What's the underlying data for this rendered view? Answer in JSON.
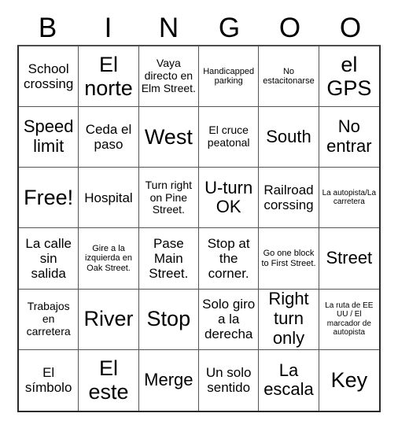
{
  "card": {
    "title": "BINGOO Card",
    "header_letters": [
      "B",
      "I",
      "N",
      "G",
      "O",
      "O"
    ],
    "columns": 6,
    "rows": 6,
    "colors": {
      "text": "#000000",
      "grid_line": "#555555",
      "border": "#2b2b2b",
      "background": "#ffffff"
    },
    "cells": [
      {
        "text": "School crossing",
        "size": "fs-md"
      },
      {
        "text": "El norte",
        "size": "fs-xl"
      },
      {
        "text": "Vaya directo en Elm Street.",
        "size": "fs-sm"
      },
      {
        "text": "Handicapped parking",
        "size": "fs-xs"
      },
      {
        "text": "No estacitonarse",
        "size": "fs-xs"
      },
      {
        "text": "el GPS",
        "size": "fs-xl"
      },
      {
        "text": "Speed limit",
        "size": "fs-lg"
      },
      {
        "text": "Ceda el paso",
        "size": "fs-md"
      },
      {
        "text": "West",
        "size": "fs-xl"
      },
      {
        "text": "El cruce peatonal",
        "size": "fs-sm"
      },
      {
        "text": "South",
        "size": "fs-lg"
      },
      {
        "text": "No entrar",
        "size": "fs-lg"
      },
      {
        "text": "Free!",
        "size": "fs-xl"
      },
      {
        "text": "Hospital",
        "size": "fs-md"
      },
      {
        "text": "Turn right on Pine Street.",
        "size": "fs-sm"
      },
      {
        "text": "U-turn OK",
        "size": "fs-lg"
      },
      {
        "text": "Railroad corssing",
        "size": "fs-md"
      },
      {
        "text": "La autopista/La carretera",
        "size": "fs-xxs"
      },
      {
        "text": "La calle sin salida",
        "size": "fs-md"
      },
      {
        "text": "Gire a la izquierda en Oak Street.",
        "size": "fs-xs"
      },
      {
        "text": "Pase Main Street.",
        "size": "fs-md"
      },
      {
        "text": "Stop at the corner.",
        "size": "fs-md"
      },
      {
        "text": "Go one block to First Street.",
        "size": "fs-xs"
      },
      {
        "text": "Street",
        "size": "fs-lg"
      },
      {
        "text": "Trabajos en carretera",
        "size": "fs-sm"
      },
      {
        "text": "River",
        "size": "fs-xl"
      },
      {
        "text": "Stop",
        "size": "fs-xl"
      },
      {
        "text": "Solo giro a la derecha",
        "size": "fs-md"
      },
      {
        "text": "Right turn only",
        "size": "fs-lg"
      },
      {
        "text": "La ruta de EE UU / El marcador de autopista",
        "size": "fs-xxs"
      },
      {
        "text": "El símbolo",
        "size": "fs-md"
      },
      {
        "text": "El este",
        "size": "fs-xl"
      },
      {
        "text": "Merge",
        "size": "fs-lg"
      },
      {
        "text": "Un solo sentido",
        "size": "fs-md"
      },
      {
        "text": "La escala",
        "size": "fs-lg"
      },
      {
        "text": "Key",
        "size": "fs-xl"
      }
    ]
  }
}
